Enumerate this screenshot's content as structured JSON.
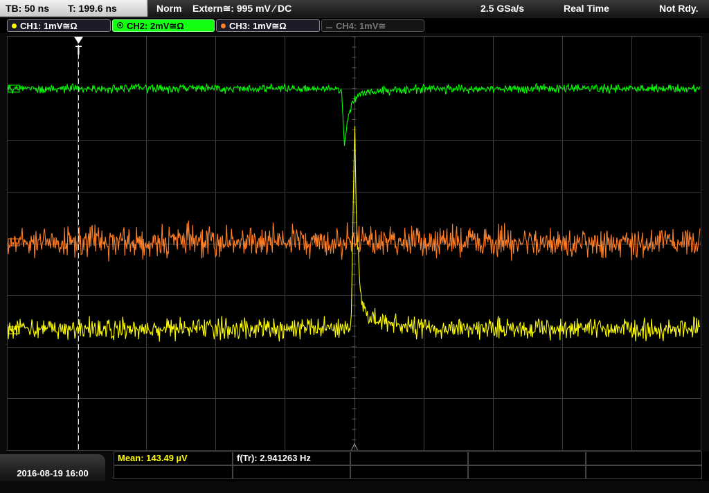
{
  "header": {
    "timebase": "TB: 50 ns",
    "trigger_time": "T: 199.6 ns",
    "mode": "Norm",
    "trigger_source": "Extern≅: 995 mV ⁄ DC",
    "sample_rate": "2.5 GSa/s",
    "acq_mode": "Real Time",
    "status": "Not Rdy."
  },
  "channels": [
    {
      "label": "CH1: 1mV≅Ω",
      "color": "#ffff00",
      "active": false,
      "enabled": true
    },
    {
      "label": "CH2: 2mV≅Ω",
      "color": "#00ff00",
      "active": true,
      "enabled": true
    },
    {
      "label": "CH3: 1mV≅Ω",
      "color": "#ff7f27",
      "active": false,
      "enabled": true
    },
    {
      "label": "CH4: 1mV≅",
      "color": "#777777",
      "active": false,
      "enabled": false
    }
  ],
  "footer": {
    "datetime": "2016-08-19 16:00",
    "mean": "Mean: 143.49 µV",
    "freq": "f(Tr): 2.941263 Hz"
  },
  "colors": {
    "ch1": "#ffff00",
    "ch2": "#00ff00",
    "ch3": "#ff7f27",
    "grid": "#3c3c3c",
    "axis": "#777777"
  },
  "icons": {
    "trigger_marker": "trigger-time-marker-icon",
    "cursor_marker": "horizontal-cursor-marker-icon"
  }
}
